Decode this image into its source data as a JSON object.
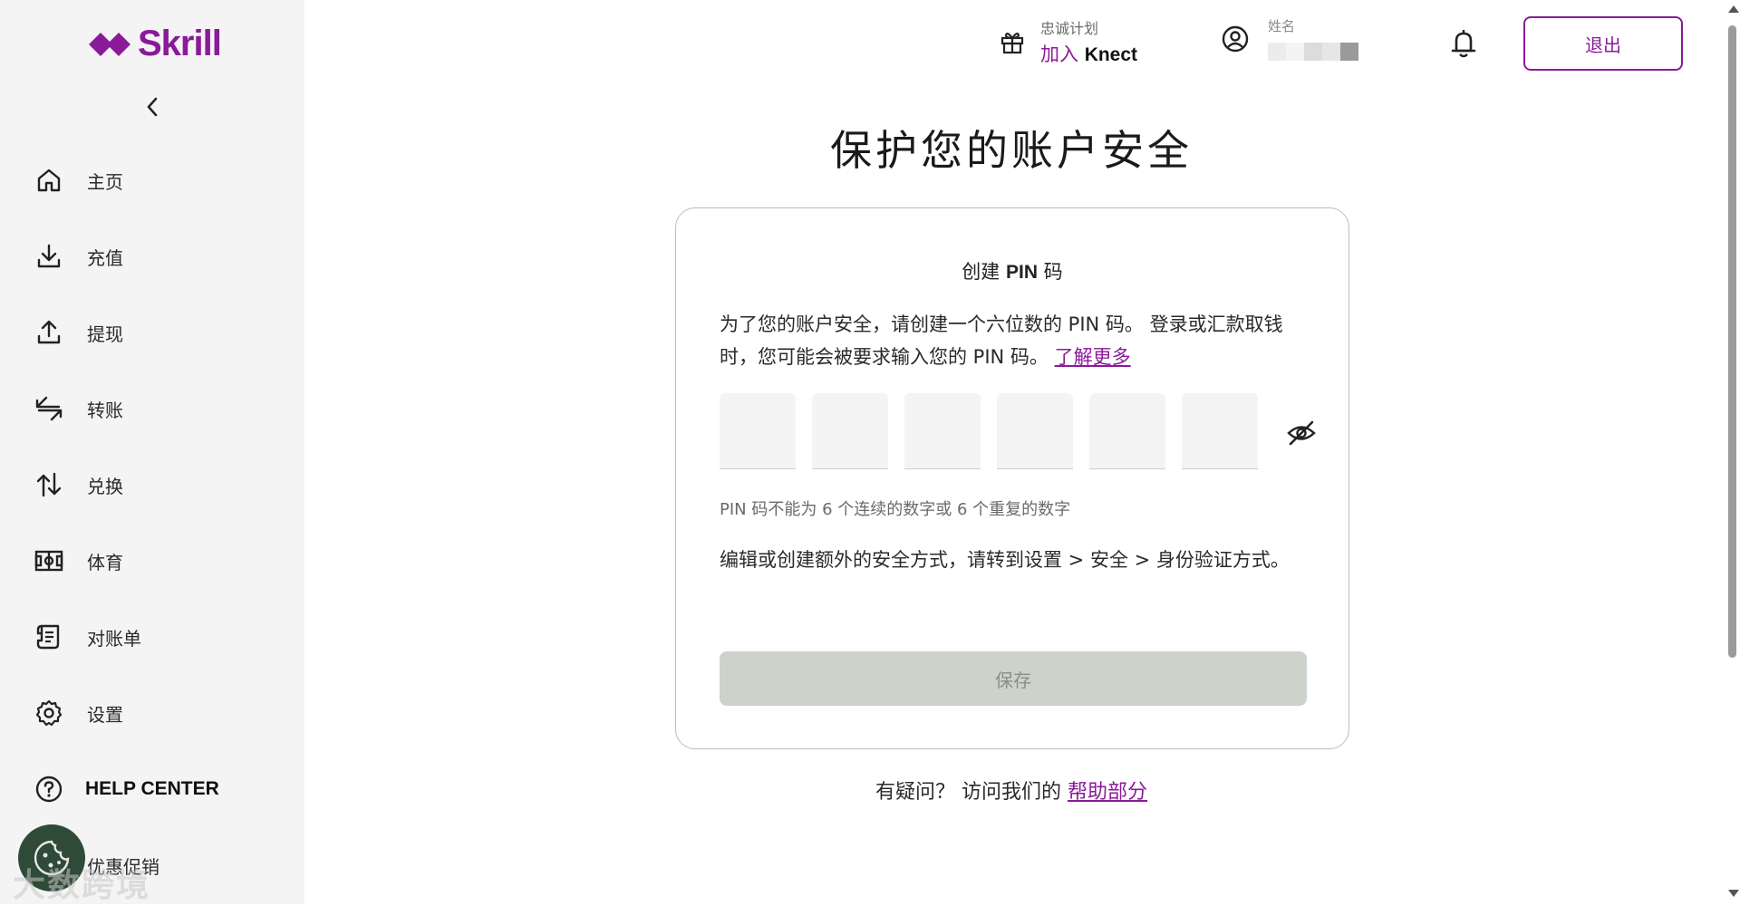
{
  "brand": {
    "name": "Skrill",
    "color": "#8a1a9a"
  },
  "sidebar": {
    "items": [
      {
        "label": "主页",
        "icon": "home-icon"
      },
      {
        "label": "充值",
        "icon": "download-icon"
      },
      {
        "label": "提现",
        "icon": "upload-icon"
      },
      {
        "label": "转账",
        "icon": "transfer-icon"
      },
      {
        "label": "兑换",
        "icon": "exchange-icon"
      },
      {
        "label": "体育",
        "icon": "stadium-icon"
      },
      {
        "label": "对账单",
        "icon": "statement-icon"
      },
      {
        "label": "设置",
        "icon": "gear-icon"
      },
      {
        "label": "HELP CENTER",
        "icon": "help-icon"
      },
      {
        "label": "优惠促销",
        "icon": "promo-icon"
      }
    ]
  },
  "header": {
    "loyalty_small": "忠诚计划",
    "loyalty_big_prefix": "加入 ",
    "loyalty_big_brand": "Knect",
    "profile_small": "姓名",
    "logout": "退出"
  },
  "main": {
    "title": "保护您的账户安全",
    "card": {
      "title_prefix": "创建 ",
      "title_bold": "PIN",
      "title_suffix": " 码",
      "desc": "为了您的账户安全，请创建一个六位数的 PIN 码。 登录或汇款取钱时，您可能会被要求输入您的 PIN 码。",
      "learn_more": "了解更多",
      "hint": "PIN 码不能为 6 个连续的数字或 6 个重复的数字",
      "note": "编辑或创建额外的安全方式，请转到设置 > 安全 > 身份验证方式。",
      "save": "保存"
    },
    "help_prefix": "有疑问？ 访问我们的 ",
    "help_link": "帮助部分"
  },
  "watermark": "大数跨境"
}
